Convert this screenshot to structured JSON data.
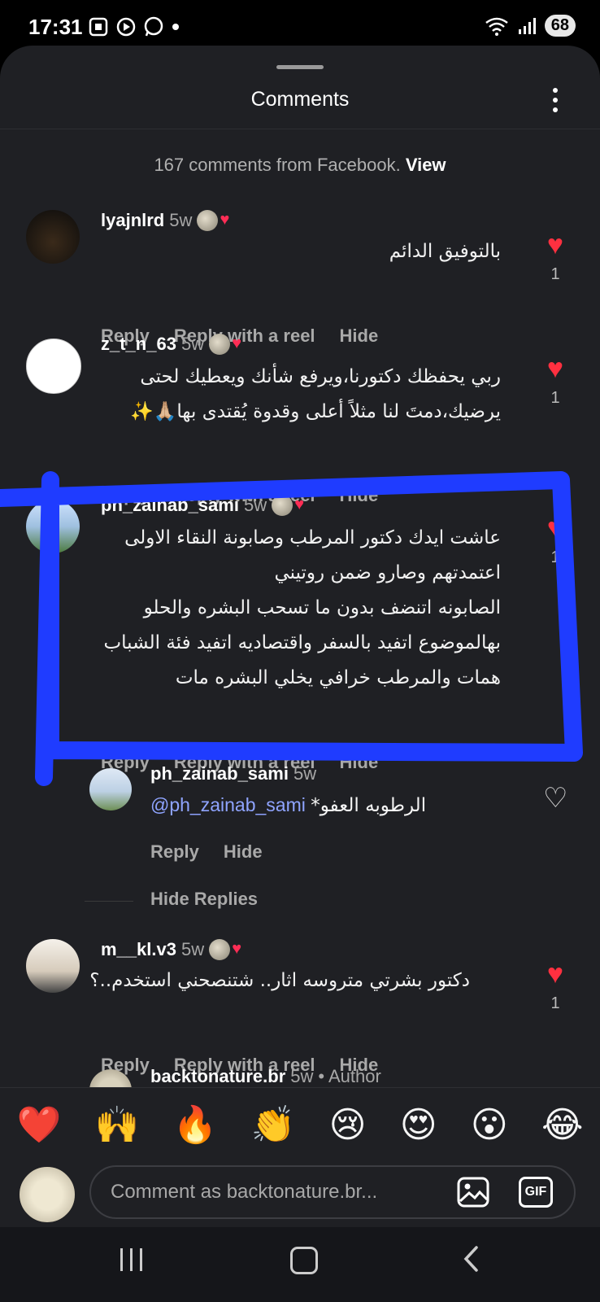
{
  "status_bar": {
    "time": "17:31",
    "battery": "68"
  },
  "header": {
    "title": "Comments"
  },
  "facebook_note": {
    "text": "167 comments from Facebook.",
    "link": "View"
  },
  "comments": [
    {
      "username": "lyajnlrd",
      "time": "5w",
      "lines": [
        "بالتوفيق الدائم"
      ],
      "actions": {
        "reply": "Reply",
        "reply_reel": "Reply with a reel",
        "hide": "Hide"
      },
      "likes": "1"
    },
    {
      "username": "z_t_n_63",
      "time": "5w",
      "lines": [
        "ربي يحفظك دكتورنا،ويرفع شأنك ويعطيك لحتى",
        "يرضيك،دمتَ لنا مثلاً أعلى  وقدوة يُقتدى بها🙏🏼✨"
      ],
      "actions": {
        "reply": "Reply",
        "reply_reel": "Reply with a reel",
        "hide": "Hide"
      },
      "likes": "1"
    },
    {
      "username": "ph_zainab_sami",
      "time": "5w",
      "lines": [
        "عاشت ايدك دكتور المرطب وصابونة النقاء الاولى",
        "اعتمدتهم وصارو ضمن روتيني",
        "الصابونه اتنضف بدون ما تسحب البشره والحلو",
        "بهالموضوع اتفيد بالسفر واقتصاديه اتفيد فئة الشباب",
        "همات والمرطب خرافي يخلي البشره مات"
      ],
      "actions": {
        "reply": "Reply",
        "reply_reel": "Reply with a reel",
        "hide": "Hide"
      },
      "likes": "1"
    },
    {
      "username": "m__kl.v3",
      "time": "5w",
      "lines": [
        "دكتور بشرتي متروسه اثار.. شتنصحني استخدم..؟"
      ],
      "actions": {
        "reply": "Reply",
        "reply_reel": "Reply with a reel",
        "hide": "Hide"
      },
      "likes": "1"
    }
  ],
  "reply": {
    "username": "ph_zainab_sami",
    "time": "5w",
    "mention": "@ph_zainab_sami",
    "text": "الرطوبه العفو*",
    "actions": {
      "reply": "Reply",
      "hide": "Hide"
    }
  },
  "hide_replies": "Hide Replies",
  "partial_comment": {
    "username": "backtonature.br",
    "time": "5w",
    "author_label": "• Author"
  },
  "emoji_bar": [
    "❤️",
    "🙌",
    "🔥",
    "👏",
    "😢",
    "😍",
    "😮",
    "😂"
  ],
  "composer": {
    "placeholder": "Comment as backtonature.br...",
    "gif_label": "GIF"
  },
  "colors": {
    "like": "#ff3040",
    "annotation": "#1f3cff",
    "mention": "#8fa4ff"
  }
}
